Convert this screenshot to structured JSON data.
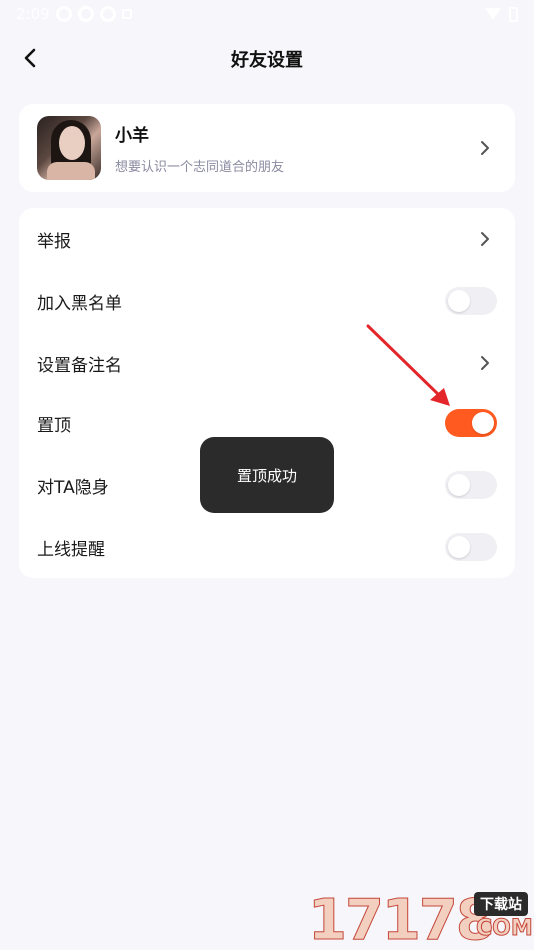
{
  "status_bar": {
    "time": "2:09"
  },
  "header": {
    "title": "好友设置"
  },
  "profile": {
    "name": "小羊",
    "signature": "想要认识一个志同道合的朋友"
  },
  "settings": {
    "items": [
      {
        "label": "举报",
        "control": "chevron"
      },
      {
        "label": "加入黑名单",
        "control": "toggle",
        "on": false
      },
      {
        "label": "设置备注名",
        "control": "chevron"
      },
      {
        "label": "置顶",
        "control": "toggle",
        "on": true
      },
      {
        "label": "对TA隐身",
        "control": "toggle",
        "on": false
      },
      {
        "label": "上线提醒",
        "control": "toggle",
        "on": false
      }
    ]
  },
  "toast": {
    "message": "置顶成功"
  },
  "colors": {
    "accent": "#ff5a1f",
    "annotation_arrow": "#e3262a",
    "background": "#f6f6fb"
  },
  "watermark": {
    "number": "17178",
    "tag": "下载站",
    "domain": "COM"
  }
}
